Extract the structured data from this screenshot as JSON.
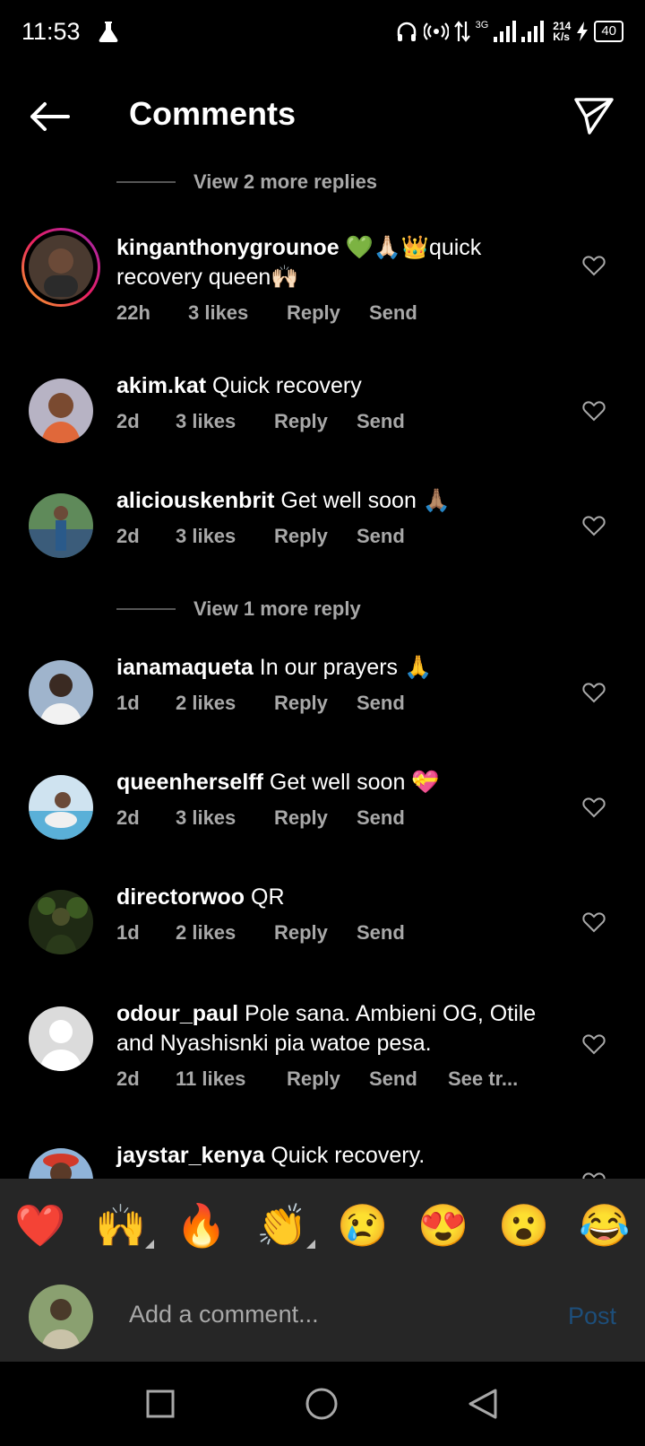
{
  "status": {
    "time": "11:53",
    "net_speed_top": "214",
    "net_speed_bottom": "K/s",
    "battery": "40",
    "network": "3G"
  },
  "header": {
    "title": "Comments"
  },
  "view_more": [
    {
      "text": "View 2 more replies"
    },
    {
      "text": "View 1 more reply"
    }
  ],
  "comments": [
    {
      "user": "kinganthonygrounoe",
      "text": " 💚🙏🏻👑quick recovery queen🙌🏻",
      "age": "22h",
      "likes": "3 likes",
      "reply": "Reply",
      "send": "Send"
    },
    {
      "user": "akim.kat",
      "text": " Quick recovery",
      "age": "2d",
      "likes": "3 likes",
      "reply": "Reply",
      "send": "Send"
    },
    {
      "user": "aliciouskenbrit",
      "text": " Get well soon 🙏🏽",
      "age": "2d",
      "likes": "3 likes",
      "reply": "Reply",
      "send": "Send"
    },
    {
      "user": "ianamaqueta",
      "text": " In our prayers 🙏",
      "age": "1d",
      "likes": "2 likes",
      "reply": "Reply",
      "send": "Send"
    },
    {
      "user": "queenherselff",
      "text": " Get well soon 💝",
      "age": "2d",
      "likes": "3 likes",
      "reply": "Reply",
      "send": "Send"
    },
    {
      "user": "directorwoo",
      "text": " QR",
      "age": "1d",
      "likes": "2 likes",
      "reply": "Reply",
      "send": "Send"
    },
    {
      "user": "odour_paul",
      "text": " Pole sana. Ambieni OG, Otile and Nyashisnki pia watoe pesa.",
      "age": "2d",
      "likes": "11 likes",
      "reply": "Reply",
      "send": "Send",
      "see": "See tr..."
    },
    {
      "user": "jaystar_kenya",
      "text": " Quick recovery."
    }
  ],
  "emoji_tray": [
    "❤️",
    "🙌",
    "🔥",
    "👏",
    "😢",
    "😍",
    "😮",
    "😂"
  ],
  "composer": {
    "placeholder": "Add a comment...",
    "post": "Post"
  },
  "colors": {
    "background": "#000000",
    "secondary_text": "#a8a8a8",
    "tray": "#262626",
    "post_disabled": "#1d4e7a"
  }
}
